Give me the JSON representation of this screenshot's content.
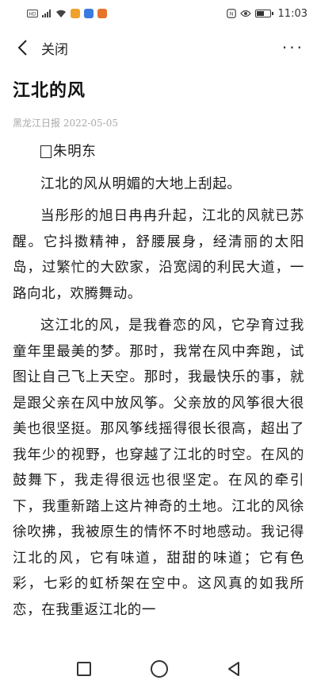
{
  "status_bar": {
    "time": "11:03",
    "battery_level": 0.5,
    "left_icons": [
      "sim-icon",
      "signal-icon",
      "wifi-icon",
      "app-notification-icon",
      "app-notification-icon",
      "app-notification-icon"
    ],
    "right_icons": [
      "nfc-icon",
      "eye-icon",
      "battery-icon"
    ]
  },
  "nav": {
    "close_label": "关闭",
    "more_label": "···"
  },
  "article": {
    "title": "江北的风",
    "meta": "黑龙江日报 2022-05-05",
    "author": "朱明东",
    "paragraphs": [
      "江北的风从明媚的大地上刮起。",
      "当彤彤的旭日冉冉升起，江北的风就已苏醒。它抖擞精神，舒腰展身，经清丽的太阳岛，过繁忙的大欧家，沿宽阔的利民大道，一路向北，欢腾舞动。",
      "这江北的风，是我眷恋的风，它孕育过我童年里最美的梦。那时，我常在风中奔跑，试图让自己飞上天空。那时，我最快乐的事，就是跟父亲在风中放风筝。父亲放的风筝很大很美也很坚挺。那风筝线摇得很长很高，超出了我年少的视野，也穿越了江北的时空。在风的鼓舞下，我走得很远也很坚定。在风的牵引下，我重新踏上这片神奇的土地。江北的风徐徐吹拂，我被原生的情怀不时地感动。我记得江北的风，它有味道，甜甜的味道；它有色彩，七彩的虹桥架在空中。这风真的如我所恋，在我重返江北的一"
    ]
  }
}
